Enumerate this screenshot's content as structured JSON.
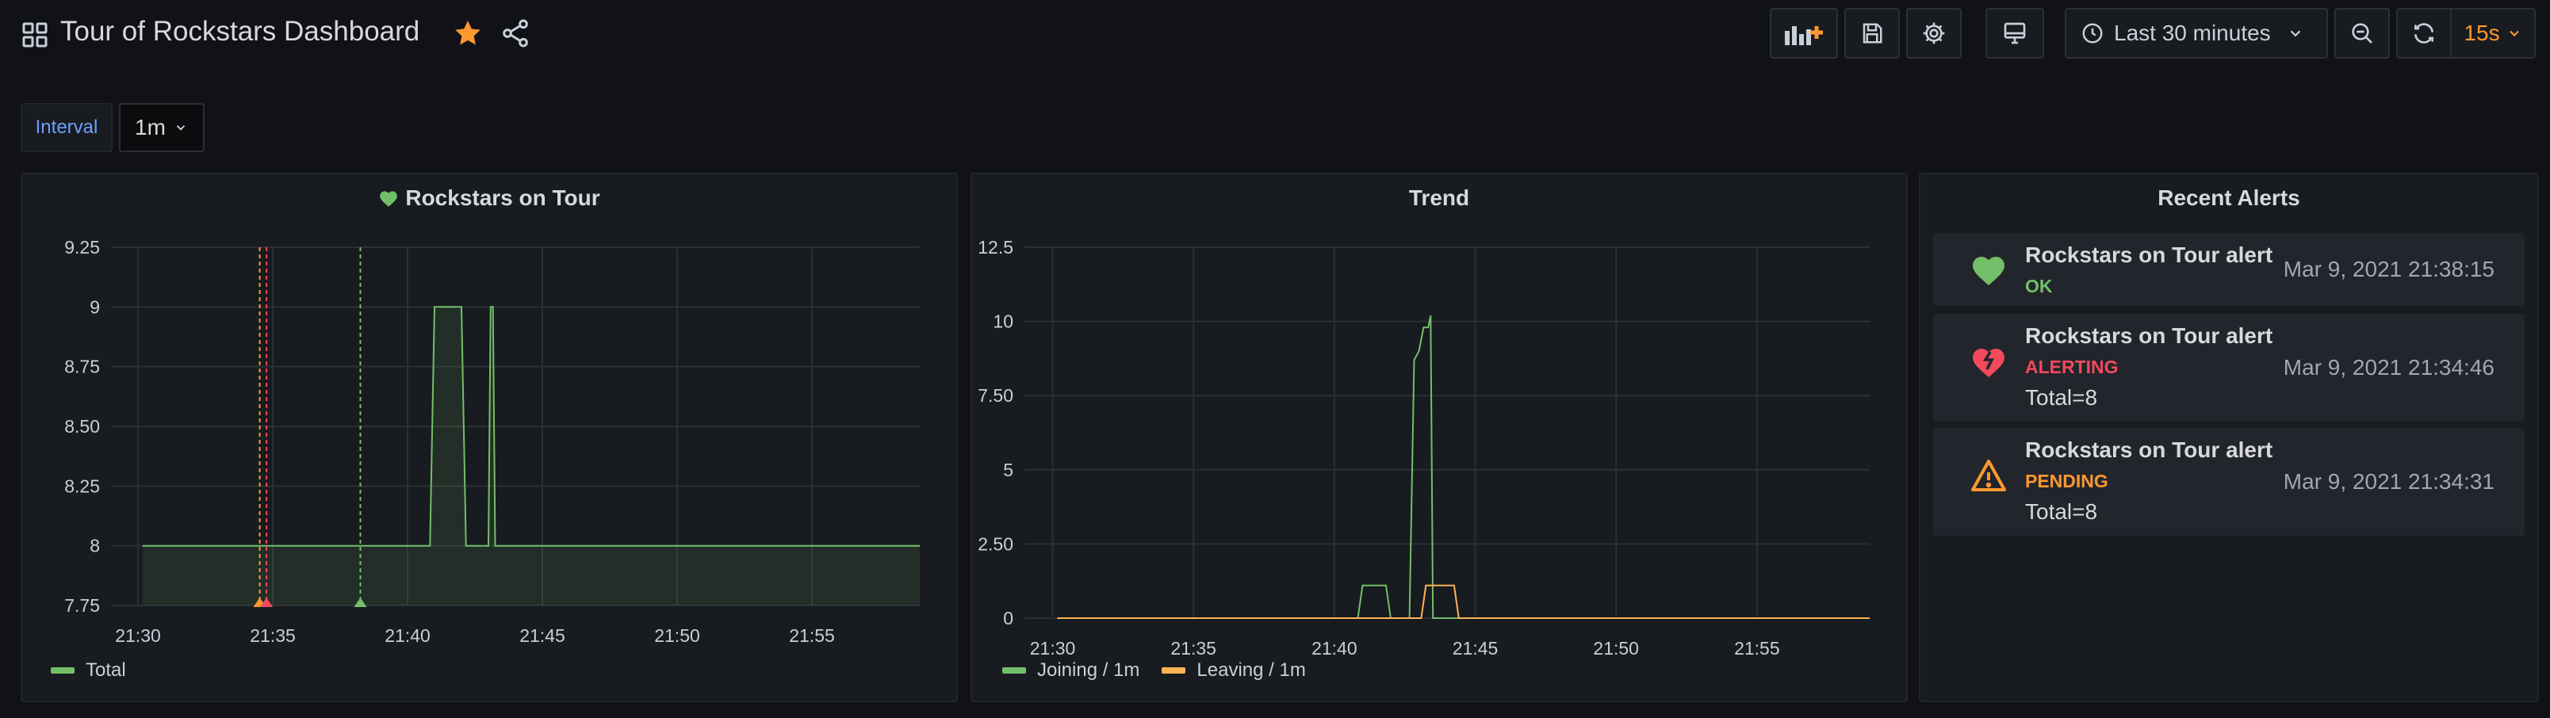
{
  "header": {
    "title": "Tour of Rockstars Dashboard",
    "time_range": "Last 30 minutes",
    "refresh_interval": "15s"
  },
  "variables": {
    "interval_label": "Interval",
    "interval_value": "1m"
  },
  "icons": {
    "apps": "apps-grid-icon",
    "star": "star-icon",
    "share": "share-icon",
    "add_panel": "add-panel-icon",
    "save": "save-icon",
    "settings": "gear-icon",
    "tv": "tv-mode-icon",
    "clock": "clock-icon",
    "zoom_out": "zoom-out-icon",
    "refresh": "refresh-icon"
  },
  "colors": {
    "background": "#111217",
    "panel": "#181b1f",
    "green": "#73bf69",
    "orange": "#ff9830",
    "yellow": "#fade2a",
    "red": "#f2495c",
    "leaving": "#ffb357"
  },
  "panels": {
    "rockstars": {
      "title": "Rockstars on Tour"
    },
    "trend": {
      "title": "Trend"
    },
    "alerts": {
      "title": "Recent Alerts",
      "items": [
        {
          "name": "Rockstars on Tour alert",
          "state": "OK",
          "info": "",
          "time": "Mar 9, 2021 21:38:15"
        },
        {
          "name": "Rockstars on Tour alert",
          "state": "ALERTING",
          "info": "Total=8",
          "time": "Mar 9, 2021 21:34:46"
        },
        {
          "name": "Rockstars on Tour alert",
          "state": "PENDING",
          "info": "Total=8",
          "time": "Mar 9, 2021 21:34:31"
        }
      ]
    }
  },
  "chart_data": [
    {
      "type": "area",
      "title": "Rockstars on Tour",
      "x_ticks": [
        "21:30",
        "21:35",
        "21:40",
        "21:45",
        "21:50",
        "21:55"
      ],
      "x_range": [
        "21:29",
        "21:59"
      ],
      "y_ticks": [
        "7.75",
        "8",
        "8.25",
        "8.50",
        "8.75",
        "9",
        "9.25"
      ],
      "ylim": [
        7.75,
        9.25
      ],
      "grid": true,
      "legend_position": "bottom-left",
      "series": [
        {
          "name": "Total",
          "x": [
            "21:30:10",
            "21:40:50",
            "21:41:00",
            "21:42:00",
            "21:42:10",
            "21:42:45",
            "21:43:00",
            "21:43:05",
            "21:43:10",
            "21:43:15",
            "21:59:00"
          ],
          "values": [
            8,
            8,
            9,
            9,
            8,
            8,
            8,
            9,
            9,
            8,
            8
          ]
        }
      ],
      "annotations": [
        {
          "time": "21:34:31",
          "state": "pending"
        },
        {
          "time": "21:34:46",
          "state": "alerting"
        },
        {
          "time": "21:38:15",
          "state": "ok"
        }
      ]
    },
    {
      "type": "line",
      "title": "Trend",
      "x_ticks": [
        "21:30",
        "21:35",
        "21:40",
        "21:45",
        "21:50",
        "21:55"
      ],
      "x_range": [
        "21:29",
        "21:59"
      ],
      "y_ticks": [
        "0",
        "2.50",
        "5",
        "7.50",
        "10",
        "12.5"
      ],
      "ylim": [
        0,
        12.5
      ],
      "grid": true,
      "legend_position": "bottom-left",
      "series": [
        {
          "name": "Joining / 1m",
          "x": [
            "21:30:10",
            "21:40:50",
            "21:41:00",
            "21:41:50",
            "21:42:00",
            "21:42:40",
            "21:42:50",
            "21:43:00",
            "21:43:10",
            "21:43:20",
            "21:43:25",
            "21:43:30",
            "21:43:40",
            "21:59:00"
          ],
          "values": [
            0,
            0,
            1.1,
            1.1,
            0,
            0,
            8.7,
            9,
            9.8,
            9.8,
            10.2,
            0,
            0,
            0
          ]
        },
        {
          "name": "Leaving / 1m",
          "x": [
            "21:30:10",
            "21:43:05",
            "21:43:15",
            "21:44:15",
            "21:44:25",
            "21:59:00"
          ],
          "values": [
            0,
            0,
            1.1,
            1.1,
            0,
            0
          ]
        }
      ]
    }
  ]
}
